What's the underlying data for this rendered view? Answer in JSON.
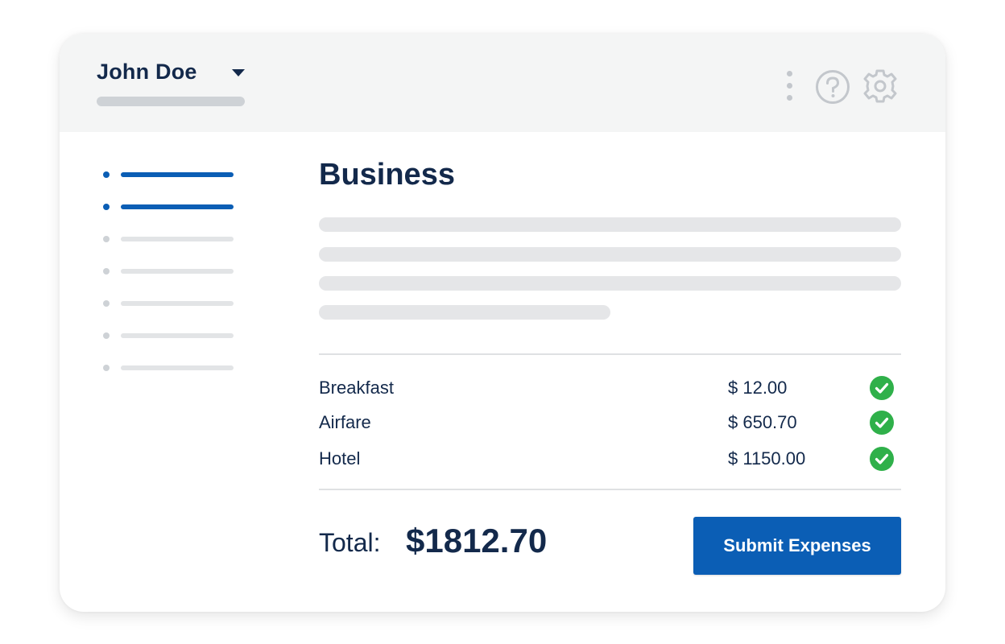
{
  "header": {
    "user_name": "John Doe",
    "icons": [
      "kebab-menu-icon",
      "help-icon",
      "gear-icon"
    ]
  },
  "sidebar": {
    "items": [
      {
        "active": true
      },
      {
        "active": true
      },
      {
        "active": false
      },
      {
        "active": false
      },
      {
        "active": false
      },
      {
        "active": false
      },
      {
        "active": false
      }
    ]
  },
  "main": {
    "title": "Business",
    "expenses": [
      {
        "name": "Breakfast",
        "amount": "$ 12.00",
        "status": "check-icon"
      },
      {
        "name": "Airfare",
        "amount": "$ 650.70",
        "status": "check-icon"
      },
      {
        "name": "Hotel",
        "amount": "$ 1150.00",
        "status": "check-icon"
      }
    ],
    "total_label": "Total:",
    "total_value": "$1812.70",
    "submit_label": "Submit Expenses"
  },
  "colors": {
    "primary": "#0b5eb5",
    "text": "#13294b",
    "header_bg": "#f4f5f5",
    "placeholder": "#e5e6e8",
    "success": "#2fb04a"
  }
}
